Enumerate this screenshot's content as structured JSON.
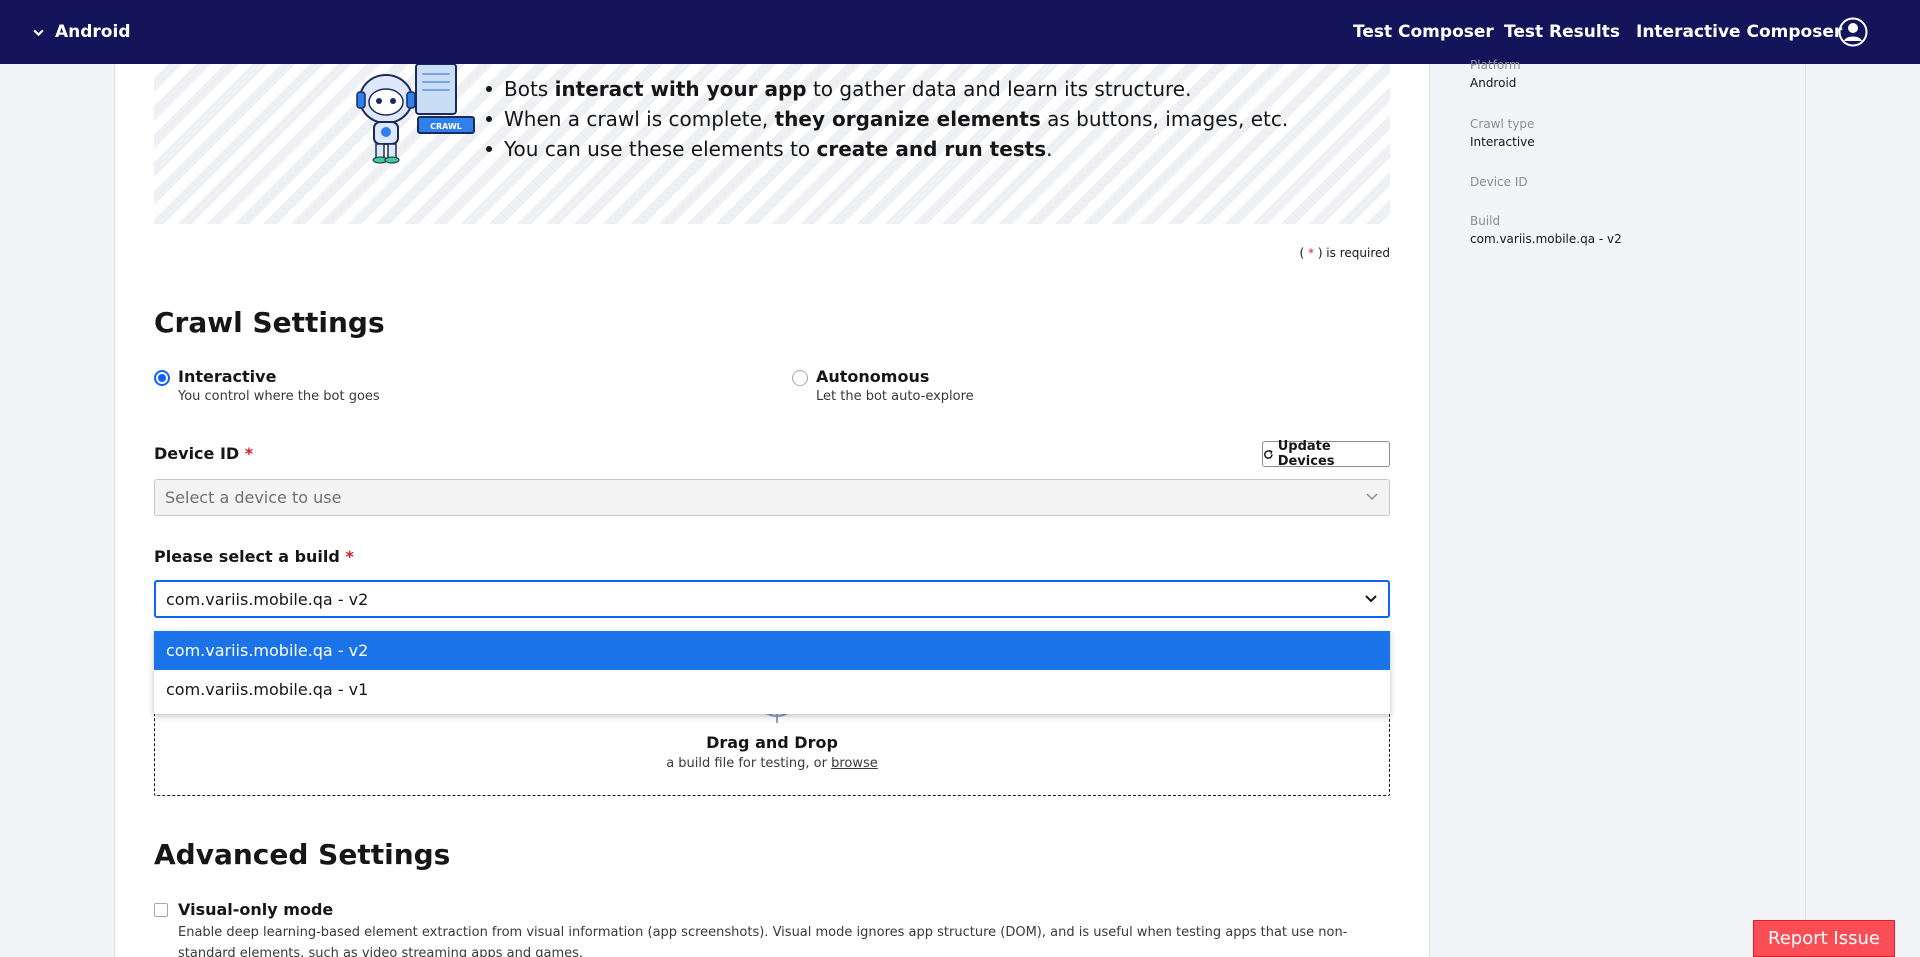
{
  "topnav": {
    "app_switch_label": "Android",
    "links": [
      "Test Composer",
      "Test Results",
      "Interactive Composer"
    ]
  },
  "hero": {
    "bullets": [
      {
        "pre": "Bots ",
        "bold": "interact with your app",
        "post": " to gather data and learn its structure."
      },
      {
        "pre": "When a crawl is complete, ",
        "bold": "they organize elements",
        "post": " as buttons, images, etc."
      },
      {
        "pre": "You can use these elements to ",
        "bold": "create and run tests",
        "post": "."
      }
    ],
    "bot_badge": "CRAWL"
  },
  "required_note": {
    "open": "( ",
    "star": "*",
    "close": " ) is required"
  },
  "crawl_settings": {
    "title": "Crawl Settings",
    "options": [
      {
        "title": "Interactive",
        "desc": "You control where the bot goes",
        "checked": true
      },
      {
        "title": "Autonomous",
        "desc": "Let the bot auto-explore",
        "checked": false
      }
    ]
  },
  "device": {
    "label": "Device ID",
    "required_mark": "*",
    "update_button": "Update Devices",
    "placeholder": "Select a device to use"
  },
  "build": {
    "label": "Please select a build",
    "required_mark": "*",
    "selected": "com.variis.mobile.qa - v2",
    "options": [
      "com.variis.mobile.qa - v2",
      "com.variis.mobile.qa - v1"
    ]
  },
  "dropzone": {
    "title": "Drag and Drop",
    "sub_text": "a build file for testing, or ",
    "browse_link": "browse"
  },
  "advanced": {
    "title": "Advanced Settings",
    "visual_mode": {
      "title": "Visual-only mode",
      "desc": "Enable deep learning-based element extraction from visual information (app screenshots). Visual mode ignores app structure (DOM), and is useful when testing apps that use non-standard elements, such as video streaming apps and games."
    }
  },
  "summary": {
    "items": [
      {
        "label": "Platform",
        "value": "Android"
      },
      {
        "label": "Crawl type",
        "value": "Interactive"
      },
      {
        "label": "Device ID",
        "value": ""
      },
      {
        "label": "Build",
        "value": "com.variis.mobile.qa - v2"
      }
    ]
  },
  "report_button": "Report Issue",
  "colors": {
    "nav_bg": "#14145a",
    "accent": "#0f62fe",
    "selected_option": "#1a73e8",
    "required": "#da1e28",
    "report": "#fa4d56"
  }
}
